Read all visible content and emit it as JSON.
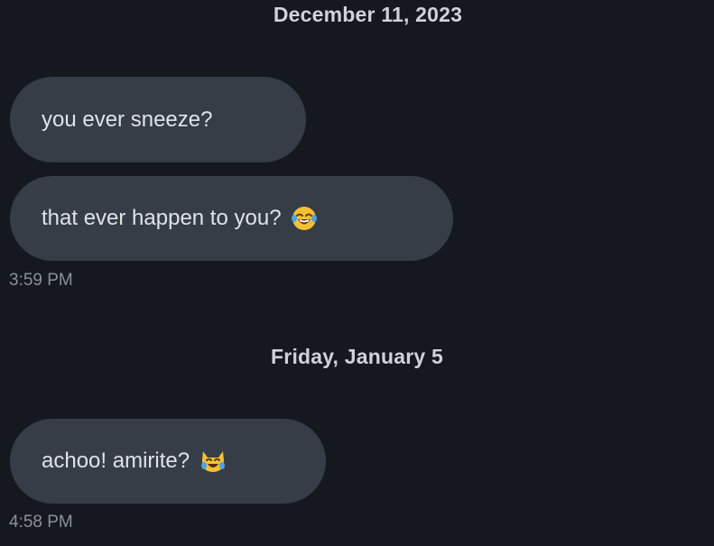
{
  "thread": {
    "groups": [
      {
        "date": "December 11, 2023",
        "messages": [
          {
            "text": "you ever sneeze?",
            "emoji": null
          },
          {
            "text": "that ever happen to you?",
            "emoji": "face-with-tears-of-joy-icon"
          }
        ],
        "time": "3:59 PM"
      },
      {
        "date": "Friday, January 5",
        "messages": [
          {
            "text": "achoo! amirite?",
            "emoji": "cat-with-tears-of-joy-icon"
          }
        ],
        "time": "4:58 PM"
      }
    ]
  },
  "colors": {
    "background": "#15181e",
    "bubble": "#363d47",
    "bubble_text": "#dfe3e8",
    "header_text": "#cfd3d9",
    "timestamp_text": "#8a919b"
  }
}
